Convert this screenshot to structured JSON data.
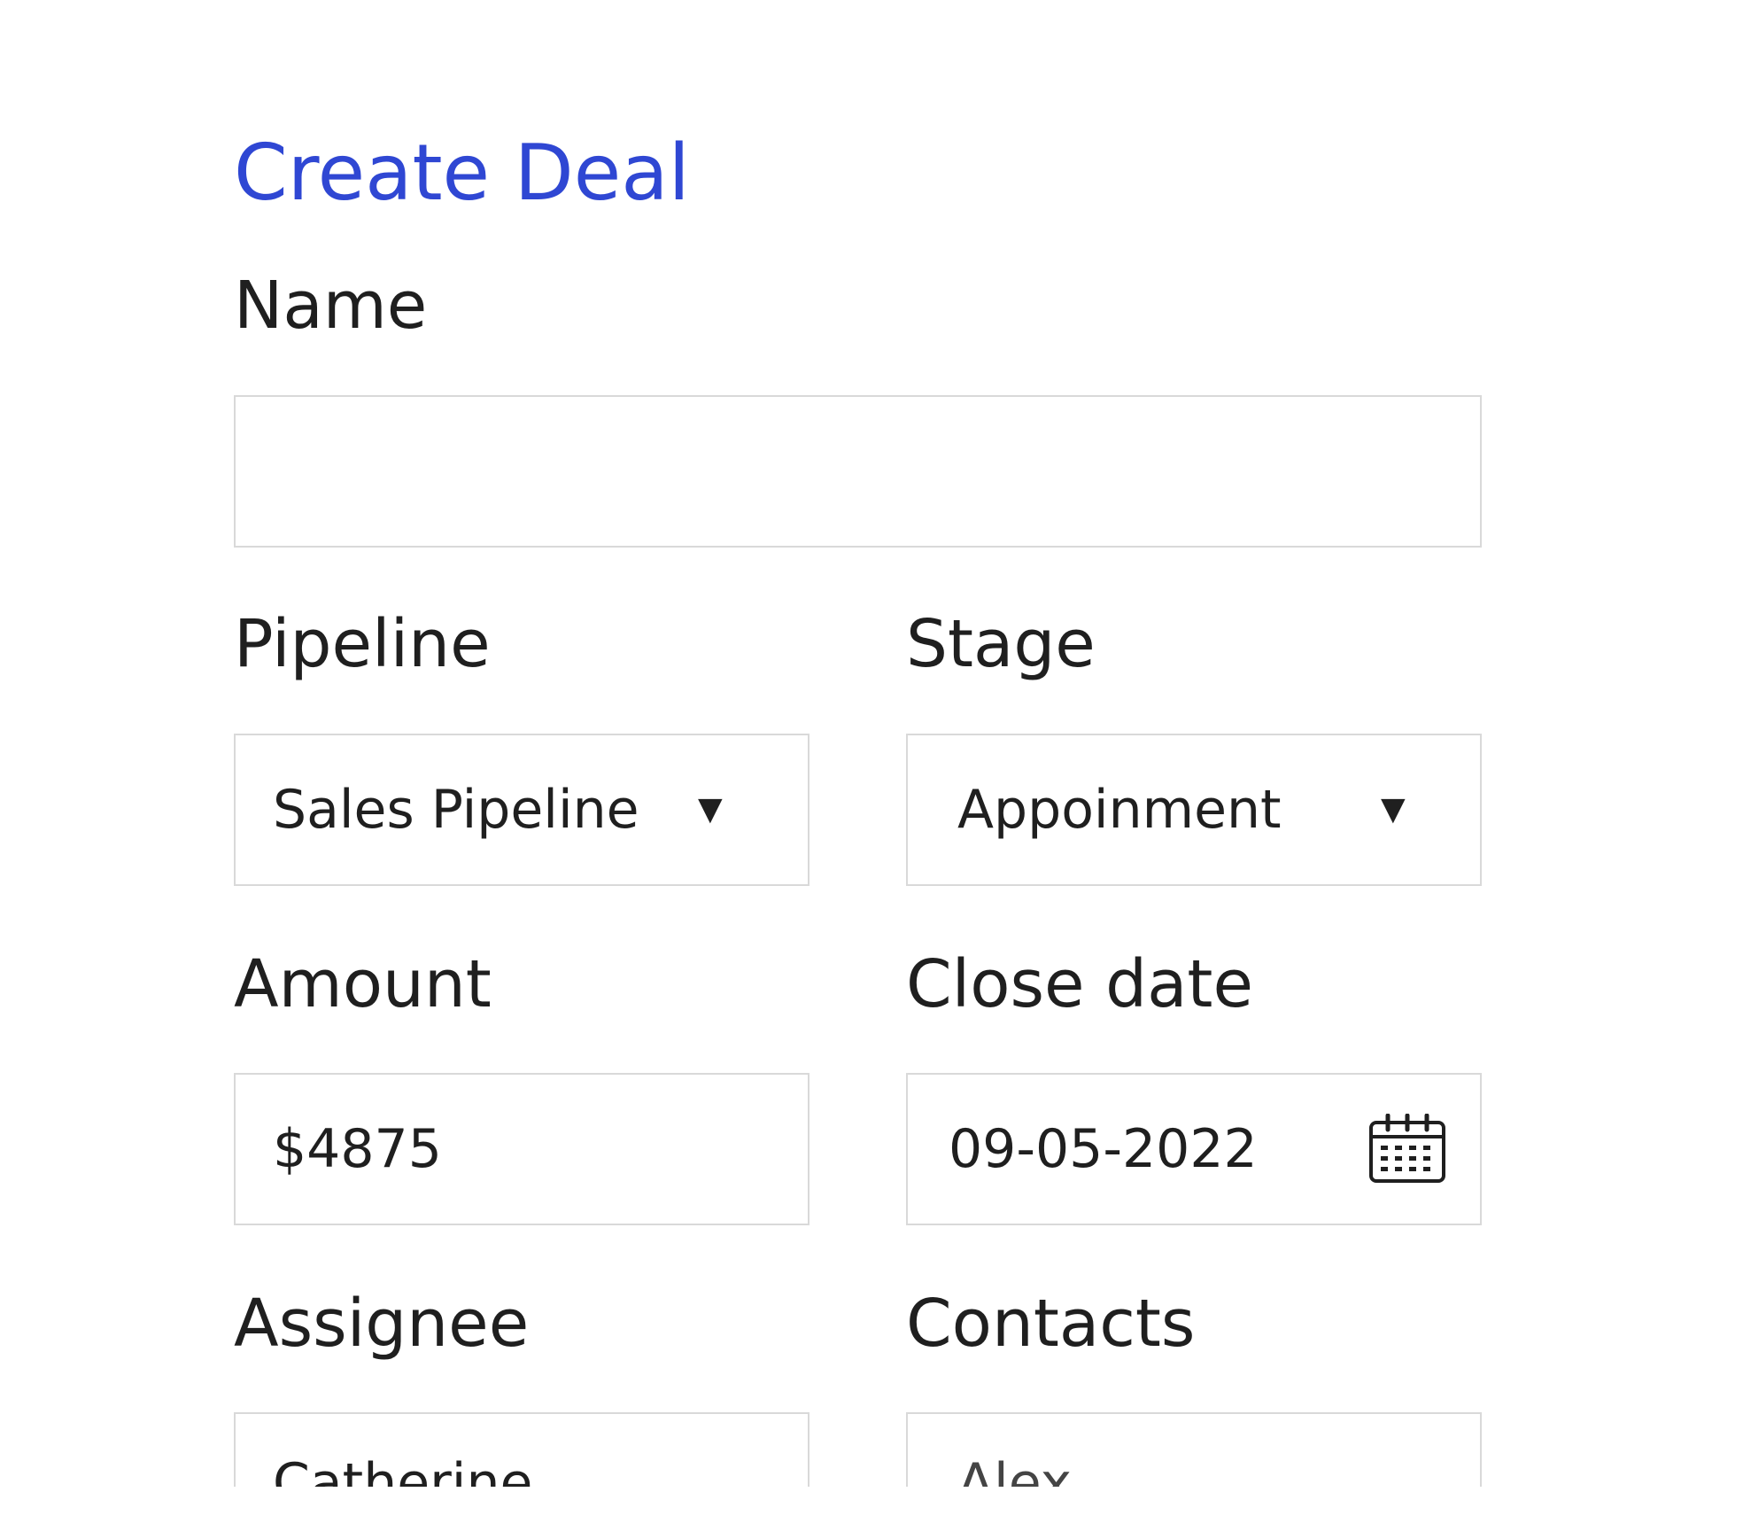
{
  "title": "Create Deal",
  "fields": {
    "name": {
      "label": "Name",
      "value": ""
    },
    "pipeline": {
      "label": "Pipeline",
      "selected": "Sales Pipeline"
    },
    "stage": {
      "label": "Stage",
      "selected": "Appoinment"
    },
    "amount": {
      "label": "Amount",
      "value": "$4875"
    },
    "close_date": {
      "label": "Close date",
      "value": "09-05-2022"
    },
    "assignee": {
      "label": "Assignee",
      "value": "Catherine"
    },
    "contacts": {
      "label": "Contacts",
      "value": "Alex"
    }
  },
  "icons": {
    "dropdown": "triangle-down-icon",
    "close_date": "calendar-icon"
  },
  "colors": {
    "title": "#2f47d3",
    "text": "#1f1f1f",
    "border": "#d9d9d9",
    "background": "#ffffff"
  }
}
